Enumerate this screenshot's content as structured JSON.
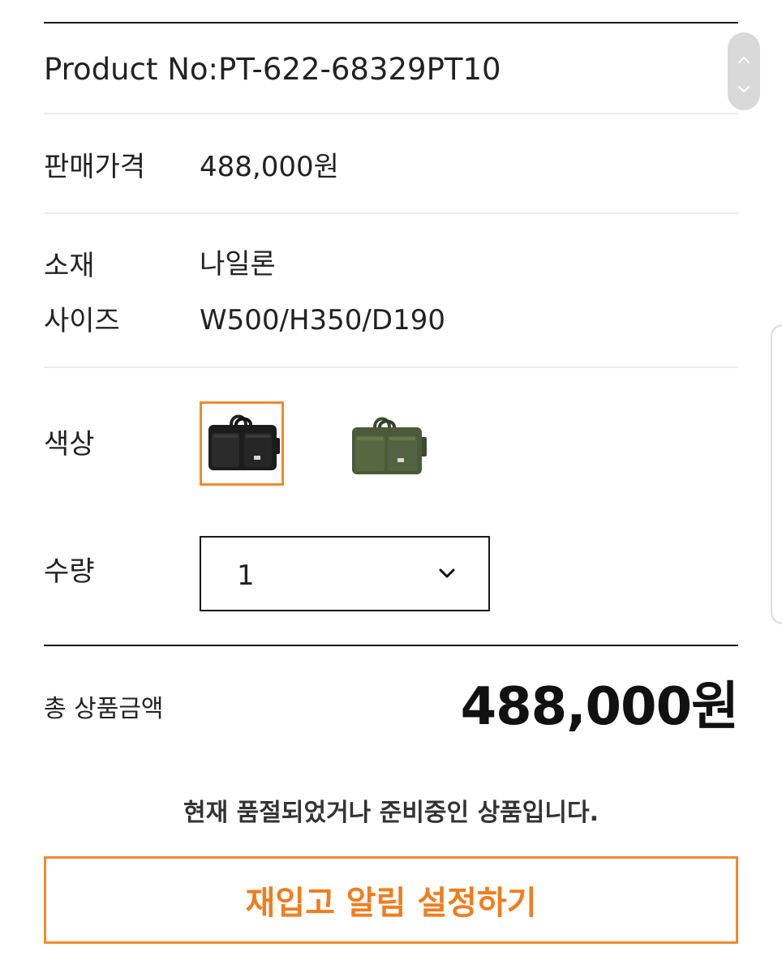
{
  "product": {
    "product_no": "Product No:PT-622-68329PT10"
  },
  "price": {
    "label": "판매가격",
    "value": "488,000원"
  },
  "specs": {
    "material_label": "소재",
    "material_value": "나일론",
    "size_label": "사이즈",
    "size_value": "W500/H350/D190"
  },
  "color": {
    "label": "색상",
    "options": [
      {
        "icon": "black-bag-thumbnail",
        "swatch": "#1b1b1b",
        "selected": true
      },
      {
        "icon": "olive-bag-thumbnail",
        "swatch": "#4b5a3c",
        "selected": false
      }
    ]
  },
  "quantity": {
    "label": "수량",
    "selected": "1",
    "icon": "chevron-down-icon"
  },
  "total": {
    "label": "총 상품금액",
    "value": "488,000원"
  },
  "status": {
    "message": "현재 품절되었거나 준비중인 상품입니다."
  },
  "restock_button": {
    "label": "재입고 알림 설정하기"
  },
  "scroll": {
    "icons": [
      "chevron-up-icon",
      "chevron-down-icon"
    ]
  },
  "colors": {
    "accent": "#f08a2c",
    "text": "#1a1a1a"
  }
}
